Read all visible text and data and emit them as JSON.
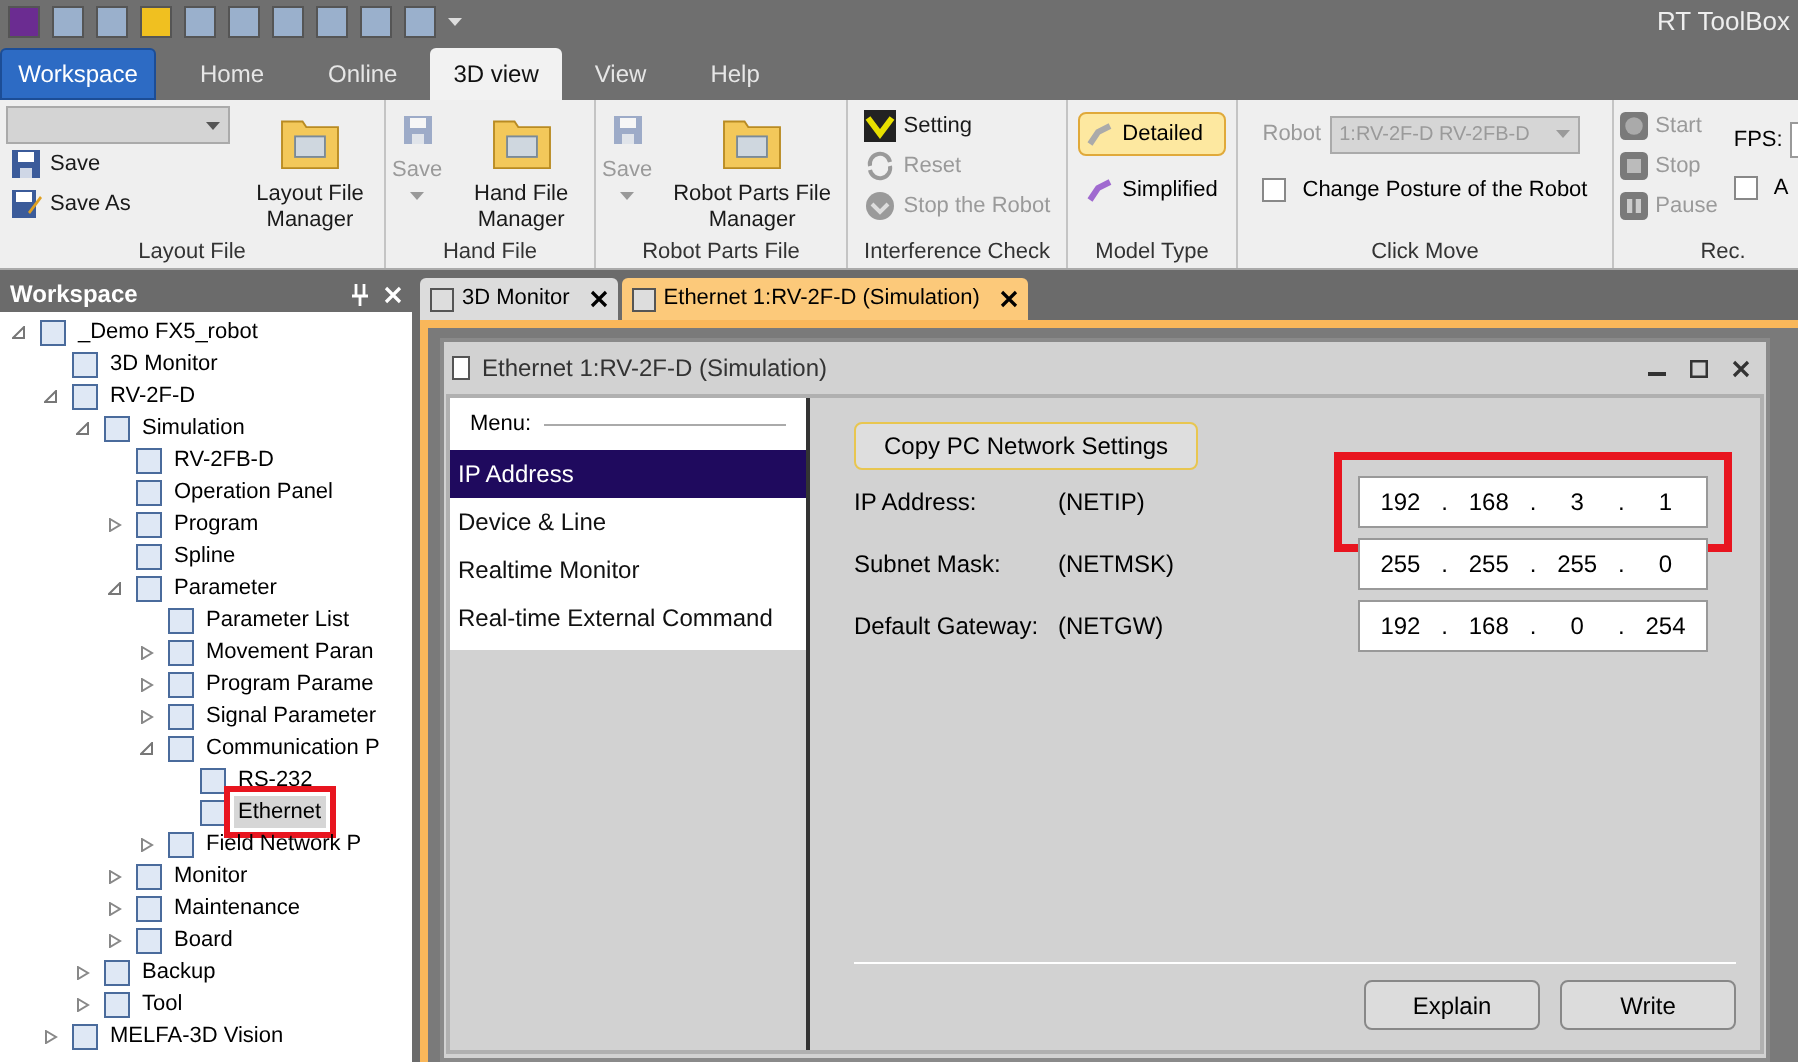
{
  "titlebar": {
    "title": "RT ToolBox"
  },
  "ribbon_tabs": [
    {
      "label": "Workspace",
      "kind": "app",
      "selected": false
    },
    {
      "label": "Home",
      "kind": "tab",
      "selected": false
    },
    {
      "label": "Online",
      "kind": "tab",
      "selected": false
    },
    {
      "label": "3D view",
      "kind": "tab",
      "selected": true
    },
    {
      "label": "View",
      "kind": "tab",
      "selected": false
    },
    {
      "label": "Help",
      "kind": "tab",
      "selected": false
    }
  ],
  "ribbon_groups": [
    {
      "label": "Layout File",
      "columns": [
        [
          {
            "kind": "combo"
          },
          {
            "kind": "small",
            "label": "Save",
            "disabled": false
          },
          {
            "kind": "small",
            "label": "Save As",
            "disabled": false
          }
        ],
        [
          {
            "kind": "large",
            "label": "Layout File Manager",
            "disabled": false
          }
        ]
      ]
    },
    {
      "label": "Hand File",
      "columns": [
        [
          {
            "kind": "large",
            "label": "Save",
            "disabled": true,
            "dropdown": true
          }
        ],
        [
          {
            "kind": "large",
            "label": "Hand File Manager",
            "disabled": false
          }
        ]
      ]
    },
    {
      "label": "Robot Parts File",
      "columns": [
        [
          {
            "kind": "large",
            "label": "Save",
            "disabled": true,
            "dropdown": true
          }
        ],
        [
          {
            "kind": "large",
            "label": "Robot Parts File Manager",
            "disabled": false
          }
        ]
      ]
    },
    {
      "label": "Interference Check",
      "columns": [
        [
          {
            "kind": "small",
            "label": "Setting",
            "disabled": false
          },
          {
            "kind": "small",
            "label": "Reset",
            "disabled": true
          },
          {
            "kind": "small",
            "label": "Stop the Robot",
            "disabled": true
          }
        ]
      ]
    },
    {
      "label": "Model Type",
      "columns": [
        [
          {
            "kind": "toggle",
            "label": "Detailed",
            "selected": true
          },
          {
            "kind": "toggle",
            "label": "Simplified",
            "selected": false
          }
        ]
      ]
    },
    {
      "label": "Click Move",
      "columns": [
        [
          {
            "kind": "labeled_combo",
            "label": "Robot",
            "value": "1:RV-2F-D RV-2FB-D",
            "disabled": true
          },
          {
            "kind": "checkbox",
            "label": "Change Posture of the Robot",
            "checked": false
          }
        ]
      ]
    },
    {
      "label": "Rec.",
      "columns": [
        [
          {
            "kind": "small",
            "label": "Start",
            "disabled": true
          },
          {
            "kind": "small",
            "label": "Stop",
            "disabled": true
          },
          {
            "kind": "small",
            "label": "Pause",
            "disabled": true
          }
        ],
        [
          {
            "kind": "fps",
            "label": "FPS:"
          },
          {
            "kind": "checkbox",
            "label": "A",
            "checked": false
          }
        ]
      ]
    }
  ],
  "workspace": {
    "title": "Workspace",
    "tree": [
      {
        "label": "_Demo FX5_robot",
        "expanded": true,
        "children": [
          {
            "label": "3D Monitor"
          },
          {
            "label": "RV-2F-D",
            "expanded": true,
            "children": [
              {
                "label": "Simulation",
                "expanded": true,
                "children": [
                  {
                    "label": "RV-2FB-D"
                  },
                  {
                    "label": "Operation Panel"
                  },
                  {
                    "label": "Program",
                    "expanded": false
                  },
                  {
                    "label": "Spline"
                  },
                  {
                    "label": "Parameter",
                    "expanded": true,
                    "children": [
                      {
                        "label": "Parameter List"
                      },
                      {
                        "label": "Movement Paran",
                        "expanded": false
                      },
                      {
                        "label": "Program Parame",
                        "expanded": false
                      },
                      {
                        "label": "Signal Parameter",
                        "expanded": false
                      },
                      {
                        "label": "Communication P",
                        "expanded": true,
                        "children": [
                          {
                            "label": "RS-232",
                            "selected": false,
                            "highlighted": false
                          },
                          {
                            "label": "Ethernet",
                            "selected": true,
                            "highlighted": true
                          }
                        ]
                      },
                      {
                        "label": "Field Network P",
                        "expanded": false
                      }
                    ]
                  },
                  {
                    "label": "Monitor",
                    "expanded": false
                  },
                  {
                    "label": "Maintenance",
                    "expanded": false
                  },
                  {
                    "label": "Board",
                    "expanded": false
                  }
                ]
              },
              {
                "label": "Backup",
                "expanded": false
              },
              {
                "label": "Tool",
                "expanded": false
              }
            ]
          },
          {
            "label": "MELFA-3D Vision",
            "expanded": false
          }
        ]
      }
    ]
  },
  "doc_tabs": [
    {
      "label": "3D Monitor",
      "selected": false
    },
    {
      "label": "Ethernet 1:RV-2F-D (Simulation)",
      "selected": true
    }
  ],
  "dialog": {
    "title": "Ethernet 1:RV-2F-D (Simulation)",
    "menu_heading": "Menu:",
    "menu": [
      {
        "label": "IP Address",
        "selected": true
      },
      {
        "label": "Device & Line",
        "selected": false
      },
      {
        "label": "Realtime Monitor",
        "selected": false
      },
      {
        "label": "Real-time External Command",
        "selected": false
      }
    ],
    "copy_button": "Copy PC Network Settings",
    "fields": [
      {
        "label": "IP Address:",
        "param": "(NETIP)",
        "parts": [
          "192",
          ".",
          "168",
          ".",
          "3",
          ".",
          "1"
        ],
        "highlighted": true
      },
      {
        "label": "Subnet Mask:",
        "param": "(NETMSK)",
        "parts": [
          "255",
          ".",
          "255",
          ".",
          "255",
          ".",
          "0"
        ],
        "highlighted": false
      },
      {
        "label": "Default Gateway:",
        "param": "(NETGW)",
        "parts": [
          "192",
          ".",
          "168",
          ".",
          "0",
          ".",
          "254"
        ],
        "highlighted": false
      }
    ],
    "buttons": [
      "Explain",
      "Write"
    ]
  }
}
